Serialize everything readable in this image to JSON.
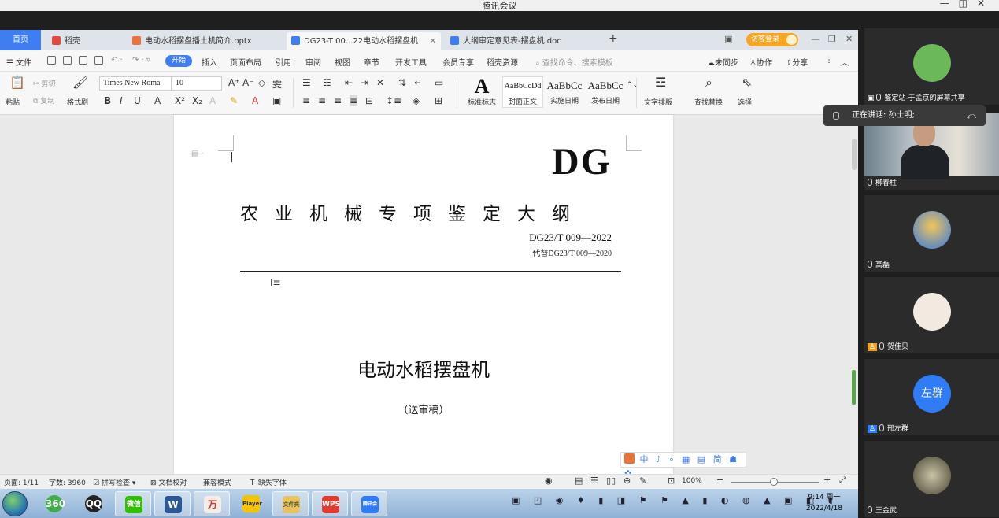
{
  "meeting": {
    "title": "腾讯会议",
    "controls": [
      "—",
      "◫",
      "✕"
    ]
  },
  "wps": {
    "tabs": [
      {
        "label": "首页"
      },
      {
        "label": "稻壳"
      },
      {
        "label": "电动水稻摆盘播土机简介.pptx"
      },
      {
        "label": "DG23-T 00...22电动水稻摆盘机"
      },
      {
        "label": "大纲审定意见表-摆盘机.doc"
      }
    ],
    "new_tab": "+",
    "login_label": "访客登录",
    "window_controls": [
      "—",
      "❐",
      "✕"
    ],
    "menu": {
      "file": "☰ 文件",
      "start": "开始",
      "items": [
        "插入",
        "页面布局",
        "引用",
        "审阅",
        "视图",
        "章节",
        "开发工具",
        "会员专享",
        "稻壳资源"
      ],
      "search_placeholder": "查找命令、搜索模板",
      "right": [
        "未同步",
        "协作",
        "分享"
      ]
    },
    "toolbar": {
      "paste": "粘贴",
      "cut": "剪切",
      "copy": "复制",
      "format_painter": "格式刷",
      "font_name": "Times New Roma",
      "font_size": "10",
      "styles": [
        {
          "preview": "A",
          "name": "标准标志"
        },
        {
          "preview": "AaBbCcDd",
          "name": "封面正文"
        },
        {
          "preview": "AaBbCc",
          "name": "实施日期"
        },
        {
          "preview": "AaBbCc",
          "name": "发布日期"
        }
      ],
      "text_layout": "文字排版",
      "find_replace": "查找替换",
      "select": "选择"
    },
    "document": {
      "code": "DG",
      "title": "农业机械专项鉴定大纲",
      "standard_no": "DG23/T 009—2022",
      "replaces": "代替DG23/T 009—2020",
      "main_title": "电动水稻摆盘机",
      "subtitle": "（送审稿）"
    },
    "ime_bar": "中 ♪ ∘ ▦ ▤ 简 ☗ ✿",
    "status": {
      "page": "页面: 1/11",
      "words": "字数: 3960",
      "spell": "拼写检查",
      "proofread": "文档校对",
      "compat": "兼容模式",
      "missing_font": "缺失字体",
      "zoom": "100%"
    }
  },
  "taskbar": {
    "apps": [
      "360",
      "QQ",
      "微信",
      "W",
      "万",
      "Player",
      "文件夹",
      "WPS",
      "腾讯会议"
    ],
    "tray": "▣ ◰ ◉ ♦ ▮ ◨ ⚑ ⚑ ▲ ▮ ◐ ◍ ▲ ▣ ◧ ◖",
    "time": "9:14 周一",
    "date": "2022/4/18"
  },
  "participants": {
    "speaking_label": "正在讲话: 孙士明;",
    "tiles": [
      {
        "name": "鉴定站-于孟京的屏幕共享",
        "avatar_color": "#6bb85a"
      },
      {
        "name": "柳春柱",
        "avatar_color": "#c69b80"
      },
      {
        "name": "高磊",
        "avatar_color": "#d9a441"
      },
      {
        "name": "贺佳贝",
        "avatar_color": "#f2e9e1"
      },
      {
        "name": "邢左群",
        "avatar_text": "左群",
        "avatar_color": "#2f7cf6"
      },
      {
        "name": "王金武",
        "avatar_color": "#9a9a7a"
      }
    ]
  }
}
